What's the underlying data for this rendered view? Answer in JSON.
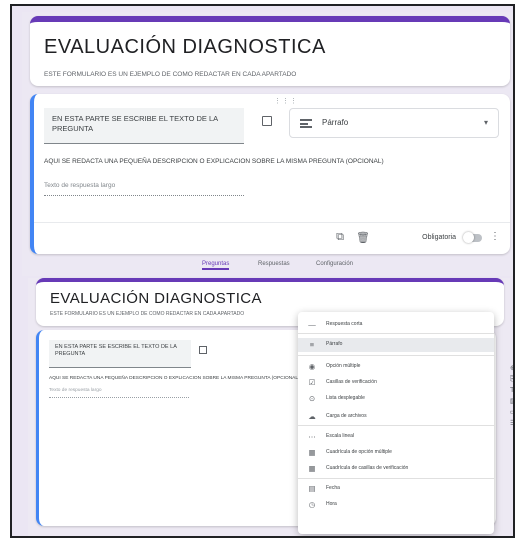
{
  "form": {
    "title": "EVALUACIÓN DIAGNOSTICA",
    "description": "ESTE FORMULARIO ES UN EJEMPLO DE COMO REDACTAR EN CADA APARTADO"
  },
  "question": {
    "text": "EN ESTA PARTE SE ESCRIBE EL TEXTO DE LA PREGUNTA",
    "type_label": "Párrafo",
    "description": "AQUI SE REDACTA UNA PEQUEÑA DESCRIPCION O EXPLICACION SOBRE LA MISMA PREGUNTA (OPCIONAL)",
    "answer_placeholder": "Texto de respuesta largo",
    "required_label": "Obligatoria"
  },
  "tabs": [
    "Preguntas",
    "Respuestas",
    "Configuración"
  ],
  "type_menu": [
    {
      "icon": "short-answer-icon",
      "glyph": "—",
      "label": "Respuesta corta"
    },
    {
      "icon": "paragraph-icon",
      "glyph": "≡",
      "label": "Párrafo",
      "selected": true
    },
    {
      "icon": "radio-icon",
      "glyph": "◉",
      "label": "Opción múltiple"
    },
    {
      "icon": "checkbox-icon",
      "glyph": "☑",
      "label": "Casillas de verificación"
    },
    {
      "icon": "dropdown-icon",
      "glyph": "⊙",
      "label": "Lista desplegable"
    },
    {
      "icon": "upload-icon",
      "glyph": "☁",
      "label": "Carga de archivos"
    },
    {
      "icon": "linear-scale-icon",
      "glyph": "⋯",
      "label": "Escala lineal"
    },
    {
      "icon": "grid-icon",
      "glyph": "▦",
      "label": "Cuadrícula de opción múltiple"
    },
    {
      "icon": "checkbox-grid-icon",
      "glyph": "▦",
      "label": "Cuadrícula de casillas de verificación"
    },
    {
      "icon": "date-icon",
      "glyph": "▤",
      "label": "Fecha"
    },
    {
      "icon": "time-icon",
      "glyph": "◷",
      "label": "Hora"
    }
  ]
}
